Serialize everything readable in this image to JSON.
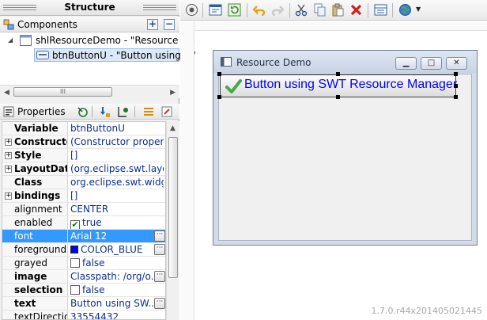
{
  "structure": {
    "title": "Structure",
    "components_label": "Components",
    "tree": [
      {
        "label": "shlResourceDemo - \"Resource Demo\"",
        "display": "shlResourceDemo - \"Resource Den"
      },
      {
        "label": "btnButtonU - \"Button using SWT Resource Manager\"",
        "display": "btnButtonU - \"Button using SW"
      }
    ],
    "scroll_thumb_label": "III"
  },
  "properties": {
    "header_label": "Properties",
    "rows": [
      {
        "name": "Variable",
        "value": "btnButtonU",
        "bold": true,
        "expandable": false
      },
      {
        "name": "Constructor",
        "value": "(Constructor proper...",
        "bold": true,
        "expandable": true
      },
      {
        "name": "Style",
        "value": "[]",
        "bold": true,
        "expandable": true
      },
      {
        "name": "LayoutData",
        "value": "(org.eclipse.swt.layo...",
        "bold": true,
        "expandable": true
      },
      {
        "name": "Class",
        "value": "org.eclipse.swt.widg...",
        "bold": true,
        "expandable": false
      },
      {
        "name": "bindings",
        "value": "[]",
        "bold": true,
        "expandable": true
      },
      {
        "name": "alignment",
        "value": "CENTER",
        "bold": false,
        "expandable": false
      },
      {
        "name": "enabled",
        "value": "true",
        "bold": false,
        "expandable": false,
        "checkbox": true,
        "checked": true
      },
      {
        "name": "font",
        "value": "Arial 12",
        "bold": false,
        "expandable": false,
        "selected": true,
        "button": true
      },
      {
        "name": "foreground",
        "value": "COLOR_BLUE",
        "bold": false,
        "expandable": false,
        "swatch": "#0000ff",
        "button": true
      },
      {
        "name": "grayed",
        "value": "false",
        "bold": false,
        "expandable": false,
        "checkbox": true,
        "checked": false
      },
      {
        "name": "image",
        "value": "Classpath: /org/o...",
        "bold": true,
        "expandable": false,
        "button": true
      },
      {
        "name": "selection",
        "value": "false",
        "bold": true,
        "expandable": false,
        "checkbox": true,
        "checked": false
      },
      {
        "name": "text",
        "value": "Button using SW...",
        "bold": true,
        "expandable": false,
        "button": true
      },
      {
        "name": "textDirection",
        "value": "33554432",
        "bold": false,
        "expandable": false
      }
    ]
  },
  "toolbar": {
    "icons": [
      "test-icon",
      "preview-icon",
      "refresh-icon",
      "undo-icon",
      "redo-icon",
      "cut-icon",
      "copy-icon",
      "paste-icon",
      "delete-icon",
      "layout-icon",
      "globe-icon",
      "dropdown-icon"
    ]
  },
  "designer": {
    "shell_title": "Resource Demo",
    "caption_minimize": "▁",
    "caption_maximize": "□",
    "caption_close": "✕",
    "button_text": "Button using SWT Resource Manager",
    "button_color": "#0000ff"
  },
  "version": "1.7.0.r44x201405021445",
  "colors": {
    "selection": "#3399ff",
    "value_text": "#0b2f8a"
  }
}
